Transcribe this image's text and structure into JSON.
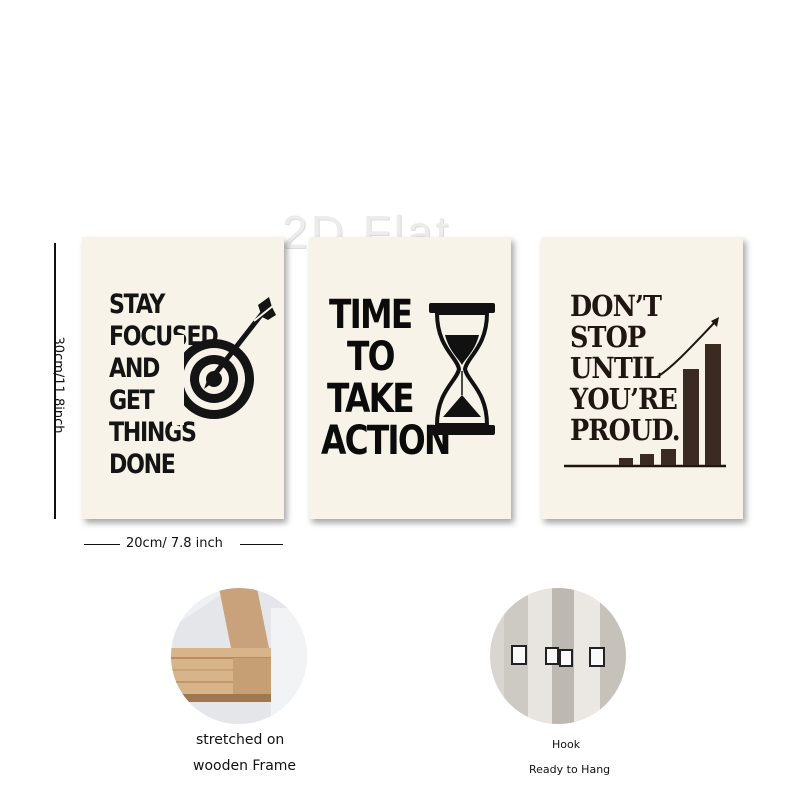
{
  "watermark": "2D Flat",
  "posters": [
    {
      "lines": [
        "STAY",
        "FOCUSED",
        "AND",
        "GET",
        "THINGS",
        "DONE"
      ],
      "icon": "target-arrow-icon"
    },
    {
      "lines": [
        "TIME",
        "TO",
        "TAKE",
        "ACTION"
      ],
      "icon": "hourglass-icon"
    },
    {
      "lines": [
        "DON’T",
        "STOP",
        "UNTIL",
        "YOU’RE",
        "PROUD."
      ],
      "icon": "growth-chart-icon"
    }
  ],
  "dimensions": {
    "height": "30cm/11.8inch",
    "width": "20cm/ 7.8 inch"
  },
  "features": [
    {
      "lines": [
        "stretched on",
        "wooden Frame"
      ],
      "icon": "wooden-frame-photo"
    },
    {
      "lines": [
        "Hook",
        "Ready to Hang"
      ],
      "icon": "hook-photo"
    }
  ],
  "colors": {
    "poster_bg": "#f8f3e8",
    "ink": "#111111",
    "chart_brown": "#3b2a22"
  }
}
